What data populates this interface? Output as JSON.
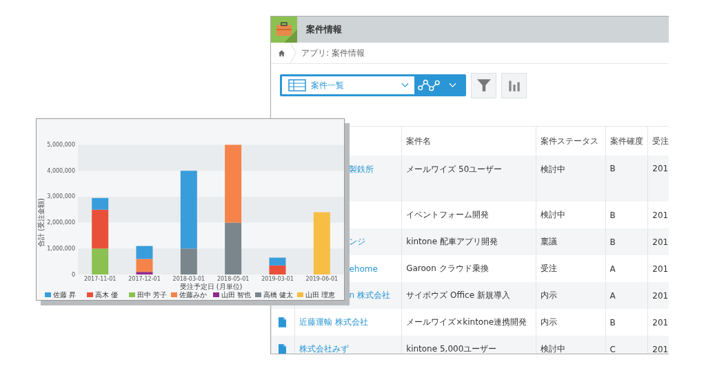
{
  "app": {
    "title": "案件情報",
    "breadcrumb": "アプリ: 案件情報",
    "view_select": "案件一覧"
  },
  "table": {
    "columns": [
      "案件名",
      "案件ステータス",
      "案件確度",
      "受注"
    ],
    "rows": [
      {
        "kind": "covered",
        "customer": "製鉄所",
        "name": "メールワイズ 50ユーザー",
        "status": "検討中",
        "certainty": "B",
        "order": "201"
      },
      {
        "kind": "covered",
        "name": "イベントフォーム開発",
        "status": "検討中",
        "certainty": "B",
        "order": "201"
      },
      {
        "kind": "covered",
        "customer": "ンジ",
        "name": "kintone 配車アプリ開発",
        "status": "稟議",
        "certainty": "B",
        "order": "201"
      },
      {
        "kind": "covered",
        "customer": "ehome",
        "name": "Garoon クラウド乗換",
        "status": "受注",
        "certainty": "A",
        "order": "201"
      },
      {
        "kind": "covered",
        "customer": "n 株式会社",
        "name": "サイボウズ Office 新規導入",
        "status": "内示",
        "certainty": "A",
        "order": "201"
      },
      {
        "kind": "record",
        "record_icon": true,
        "customer": "近藤運輸 株式会社",
        "name": "メールワイズ×kintone連携開発",
        "status": "内示",
        "certainty": "B",
        "order": "201"
      },
      {
        "kind": "record",
        "record_icon": true,
        "customer": "株式会社みず",
        "name": "kintone 5,000ユーザー",
        "status": "検討中",
        "certainty": "C",
        "order": "201"
      }
    ]
  },
  "chart_panel": {
    "chart_data": {
      "type": "bar",
      "stacked": true,
      "xlabel": "受注予定日 (月単位)",
      "ylabel": "合計 (受注金額)",
      "categories": [
        "2017-11-01",
        "2017-12-01",
        "2018-03-01",
        "2018-05-01",
        "2019-03-01",
        "2019-06-01"
      ],
      "ylim": [
        0,
        5000000
      ],
      "legend": true,
      "yticks": [
        {
          "value": 0,
          "label": "0"
        },
        {
          "value": 1000000,
          "label": "1,000,000"
        },
        {
          "value": 2000000,
          "label": "2,000,000"
        },
        {
          "value": 3000000,
          "label": "3,000,000"
        },
        {
          "value": 4000000,
          "label": "4,000,000"
        },
        {
          "value": 5000000,
          "label": "5,000,000"
        }
      ],
      "series": [
        {
          "name": "佐藤 昇",
          "color": "#3a9ddb",
          "values": [
            450000,
            500000,
            3000000,
            null,
            300000,
            null
          ]
        },
        {
          "name": "高木 優",
          "color": "#e9503a",
          "values": [
            1500000,
            null,
            null,
            null,
            350000,
            null
          ]
        },
        {
          "name": "田中 芳子",
          "color": "#8cc152",
          "values": [
            1000000,
            null,
            null,
            null,
            null,
            null
          ]
        },
        {
          "name": "佐藤みか",
          "color": "#f5834a",
          "values": [
            null,
            500000,
            null,
            3000000,
            null,
            null
          ]
        },
        {
          "name": "山田 智也",
          "color": "#8e2c8a",
          "values": [
            null,
            100000,
            null,
            null,
            null,
            null
          ]
        },
        {
          "name": "高橋 健太",
          "color": "#7b868c",
          "values": [
            null,
            null,
            1000000,
            2000000,
            null,
            null
          ]
        },
        {
          "name": "山田 理恵",
          "color": "#f7bd45",
          "values": [
            null,
            null,
            null,
            null,
            null,
            2400000
          ]
        }
      ]
    }
  }
}
